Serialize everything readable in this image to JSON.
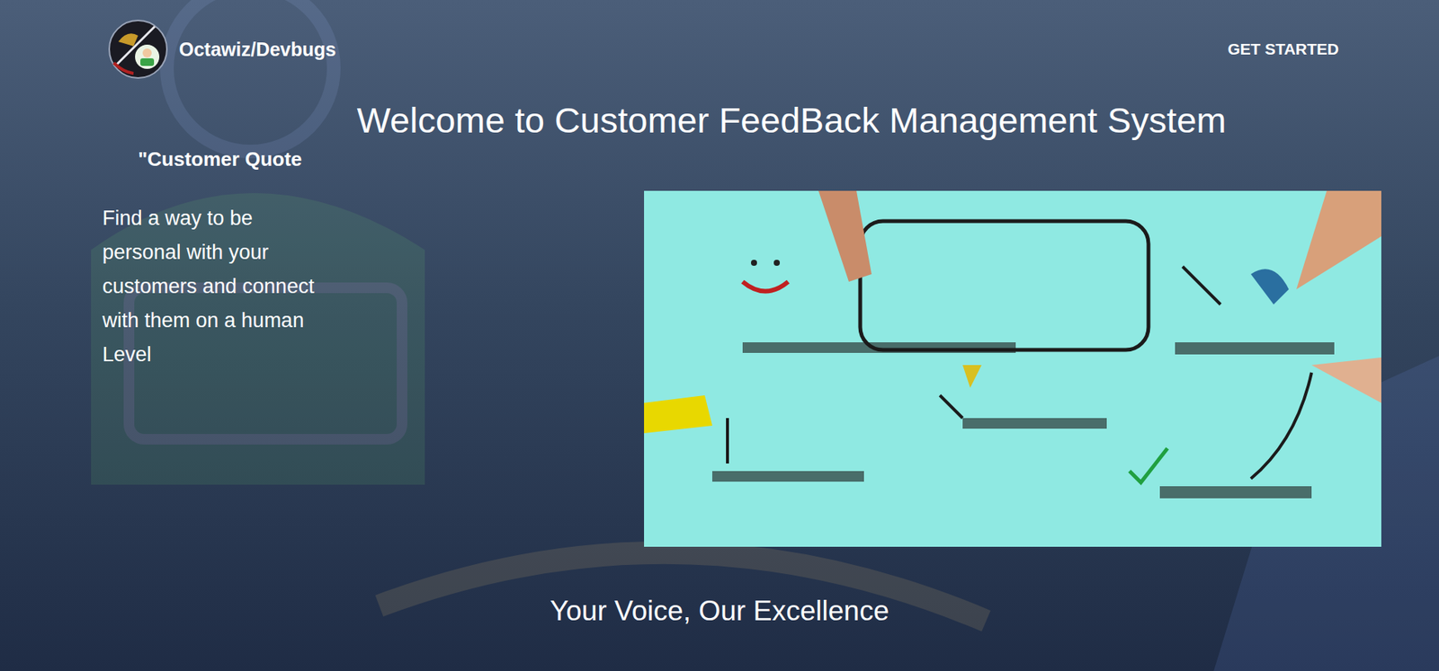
{
  "header": {
    "brand": "Octawiz/Devbugs",
    "cta": "GET STARTED"
  },
  "title": "Welcome to Customer FeedBack Management System",
  "quote": {
    "heading": "\"Customer Quote",
    "text": "Find a way to be personal with your customers and connect with them on a human Level"
  },
  "tagline": "Your Voice, Our Excellence"
}
